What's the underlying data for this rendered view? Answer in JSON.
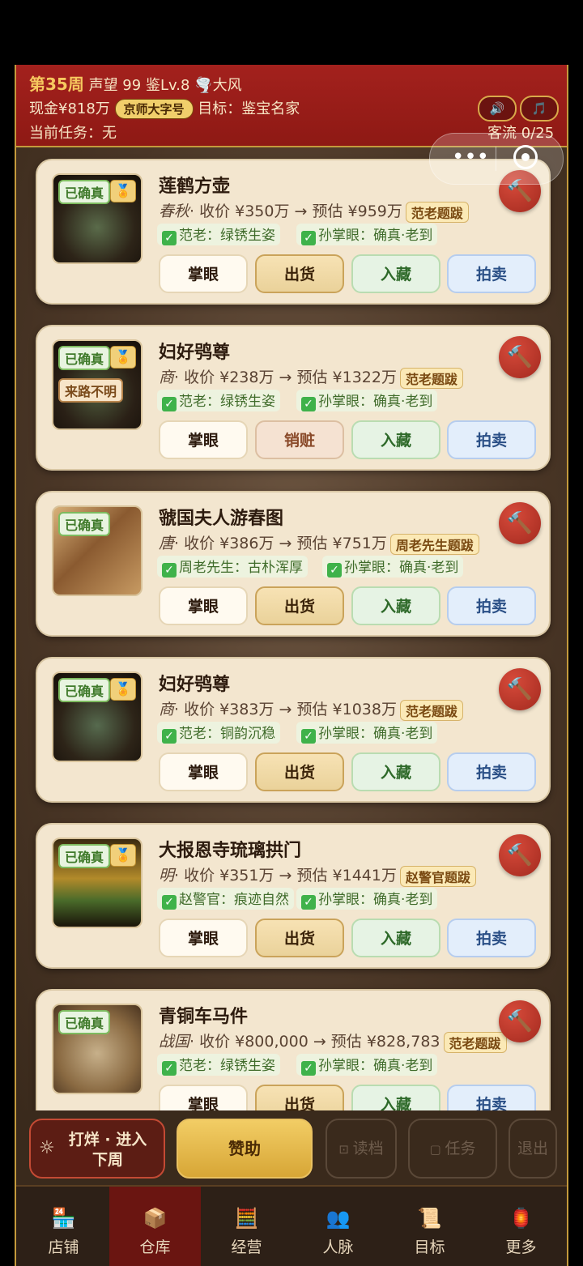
{
  "header": {
    "week": "第35周",
    "reputation": "声望 99",
    "level": "鉴Lv.8",
    "weather": "🌪️大风",
    "cash": "现金¥818万",
    "shop_badge": "京师大字号",
    "goal": "目标：鉴宝名家",
    "task": "当前任务：无",
    "customers": "客流 0/25",
    "sound_icon": "🔊",
    "music_icon": "🎵"
  },
  "items": [
    {
      "name": "莲鹤方壶",
      "era": "春秋",
      "buy": "· 收价 ¥350万 → 预估 ¥959万",
      "tag": "范老题跋",
      "badge": "已确真",
      "medal": true,
      "warn": "",
      "check1": "范老：绿锈生姿",
      "check2": "孙掌眼：确真·老到",
      "sell_label": "出货",
      "sell_alt": false
    },
    {
      "name": "妇好鸮尊",
      "era": "商",
      "buy": "· 收价 ¥238万 → 预估 ¥1322万",
      "tag": "范老题跋",
      "badge": "已确真",
      "medal": true,
      "warn": "来路不明",
      "check1": "范老：绿锈生姿",
      "check2": "孙掌眼：确真·老到",
      "sell_label": "销赃",
      "sell_alt": true
    },
    {
      "name": "虢国夫人游春图",
      "era": "唐",
      "buy": "· 收价 ¥386万 → 预估 ¥751万",
      "tag": "周老先生题跋",
      "badge": "已确真",
      "medal": false,
      "warn": "",
      "check1": "周老先生：古朴浑厚",
      "check2": "孙掌眼：确真·老到",
      "sell_label": "出货",
      "sell_alt": false
    },
    {
      "name": "妇好鸮尊",
      "era": "商",
      "buy": "· 收价 ¥383万 → 预估 ¥1038万",
      "tag": "范老题跋",
      "badge": "已确真",
      "medal": true,
      "warn": "",
      "check1": "范老：铜韵沉稳",
      "check2": "孙掌眼：确真·老到",
      "sell_label": "出货",
      "sell_alt": false
    },
    {
      "name": "大报恩寺琉璃拱门",
      "era": "明",
      "buy": "· 收价 ¥351万 → 预估 ¥1441万",
      "tag": "赵警官题跋",
      "badge": "已确真",
      "medal": true,
      "warn": "",
      "check1": "赵警官：痕迹自然",
      "check2": "孙掌眼：确真·老到",
      "sell_label": "出货",
      "sell_alt": false
    },
    {
      "name": "青铜车马件",
      "era": "战国",
      "buy": "· 收价 ¥800,000 → 预估 ¥828,783",
      "tag": "范老题跋",
      "badge": "已确真",
      "medal": false,
      "warn": "",
      "check1": "范老：绿锈生姿",
      "check2": "孙掌眼：确真·老到",
      "sell_label": "出货",
      "sell_alt": false
    }
  ],
  "buttons": {
    "eye": "掌眼",
    "store": "入藏",
    "auction": "拍卖",
    "medal_icon": "🏅",
    "hammer_icon": "🔨"
  },
  "actions": {
    "next_week": "打烊 · 进入下周",
    "next_icon": "☼",
    "sponsor": "赞助",
    "load": "读档",
    "task": "任务",
    "quit": "退出"
  },
  "tabs": [
    {
      "label": "店铺",
      "icon": "🏪"
    },
    {
      "label": "仓库",
      "icon": "📦"
    },
    {
      "label": "经营",
      "icon": "🧮"
    },
    {
      "label": "人脉",
      "icon": "👥"
    },
    {
      "label": "目标",
      "icon": "📜"
    },
    {
      "label": "更多",
      "icon": "🏮"
    }
  ],
  "active_tab": 1
}
